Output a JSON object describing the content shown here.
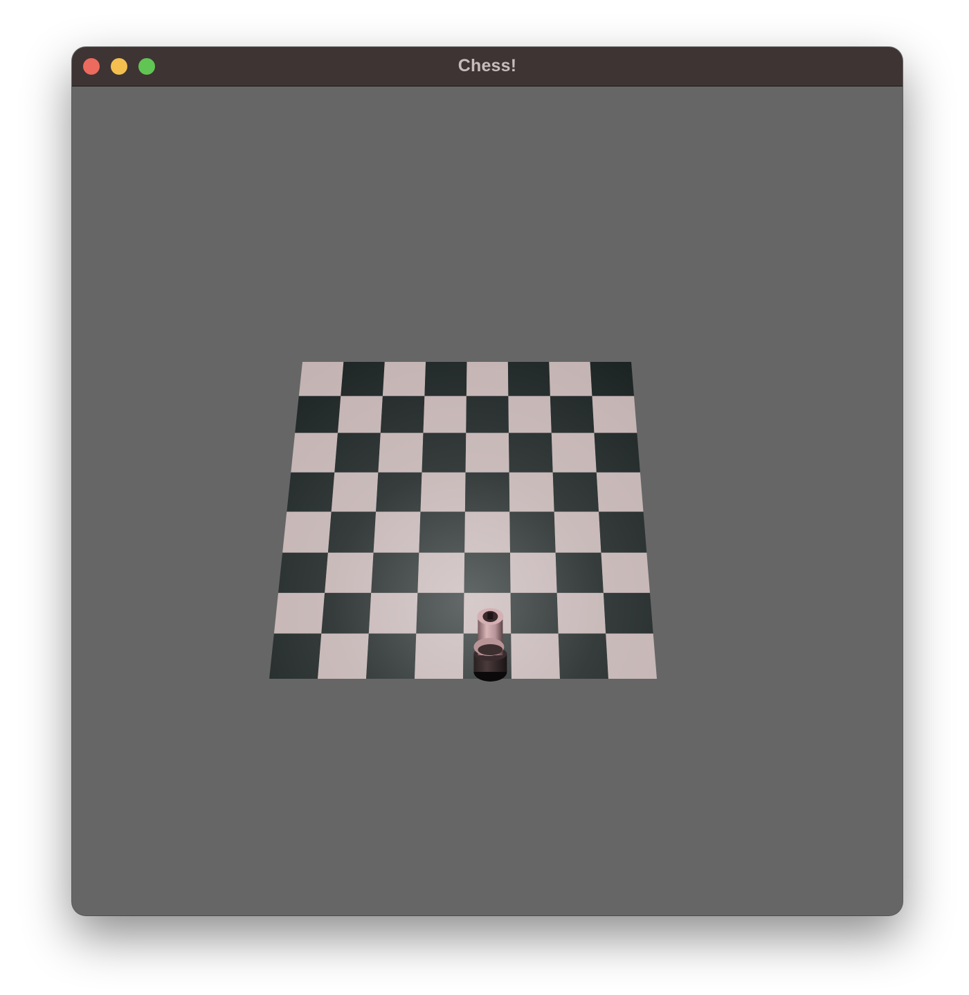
{
  "window": {
    "title": "Chess!",
    "buttons": {
      "close": "close",
      "minimize": "minimize",
      "zoom": "zoom"
    }
  },
  "scene": {
    "background_color": "#666666",
    "board": {
      "ranks": 8,
      "files": 8,
      "light_square_color": "#c3b2b2",
      "dark_square_color": "#1b2222"
    },
    "pieces": [
      {
        "type": "rook",
        "file": 4,
        "rank": 7,
        "color": "#c9a6a8"
      }
    ]
  }
}
